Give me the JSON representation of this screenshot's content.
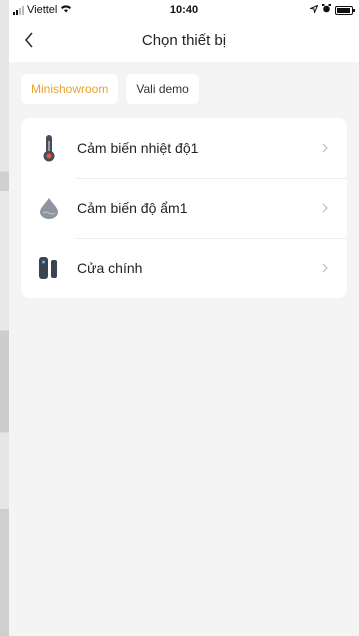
{
  "status_bar": {
    "carrier": "Viettel",
    "time": "10:40"
  },
  "nav": {
    "title": "Chọn thiết bị"
  },
  "rooms": [
    {
      "label": "Minishowroom",
      "active": true
    },
    {
      "label": "Vali demo",
      "active": false
    }
  ],
  "devices": [
    {
      "name": "Cảm biến nhiệt độ1",
      "icon": "thermometer-icon"
    },
    {
      "name": "Cảm biến độ ẩm1",
      "icon": "water-drop-icon"
    },
    {
      "name": "Cửa chính",
      "icon": "door-sensor-icon"
    }
  ],
  "colors": {
    "accent": "#e9a233",
    "background": "#f4f4f4",
    "card": "#ffffff"
  }
}
